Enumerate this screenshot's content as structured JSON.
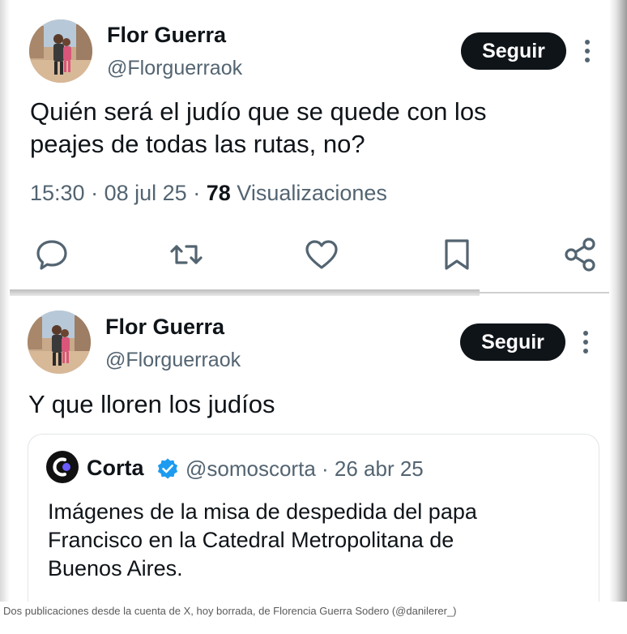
{
  "post_1": {
    "author_name": "Flor Guerra",
    "author_handle": "@Florguerraok",
    "follow_label": "Seguir",
    "text_lines": [
      "Quién será el judío que se quede con los",
      "peajes de todas las rutas, no?"
    ],
    "time": "15:30",
    "separator": "·",
    "date": "08 jul 25",
    "views_count": "78",
    "views_label": "Visualizaciones",
    "actions": [
      "reply-icon",
      "retweet-icon",
      "like-icon",
      "bookmark-icon",
      "share-icon"
    ]
  },
  "post_2": {
    "author_name": "Flor Guerra",
    "author_handle": "@Florguerraok",
    "follow_label": "Seguir",
    "text": "Y que lloren los judíos",
    "quoted": {
      "author_name": "Corta",
      "author_handle_date": "@somoscorta · 26 abr 25",
      "text_lines": [
        "Imágenes de la misa de despedida del papa",
        "Francisco en la Catedral Metropolitana de",
        "Buenos Aires."
      ],
      "verified": true
    }
  },
  "caption": "Dos publicaciones desde la cuenta de X, hoy borrada, de Florencia Guerra Sodero (@danilerer_)",
  "colors": {
    "text_primary": "#0f1419",
    "text_secondary": "#536471",
    "button_bg": "#0f1419",
    "verified_blue": "#1d9bf0",
    "action_icon": "#536471"
  }
}
